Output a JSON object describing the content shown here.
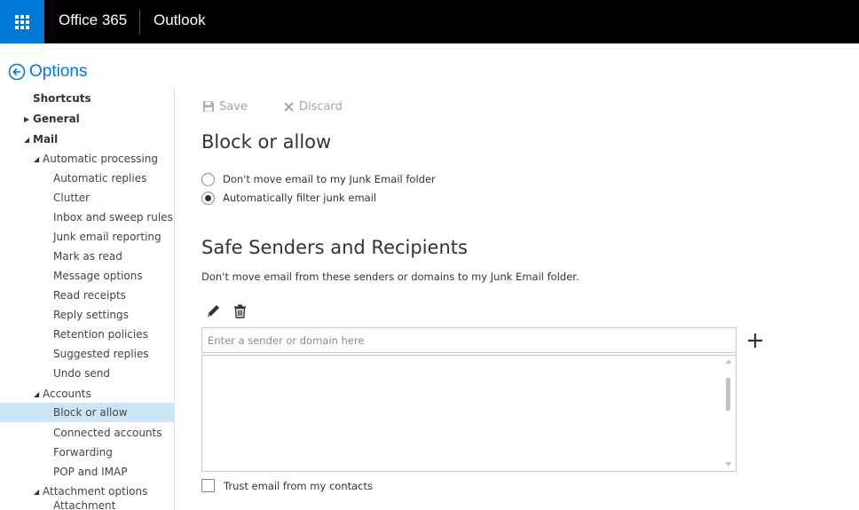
{
  "topbar": {
    "brand": "Office 365",
    "app": "Outlook"
  },
  "options": {
    "title": "Options"
  },
  "sidebar": {
    "items": [
      {
        "label": "Shortcuts"
      },
      {
        "label": "General"
      },
      {
        "label": "Mail"
      },
      {
        "label": "Automatic processing"
      },
      {
        "label": "Automatic replies"
      },
      {
        "label": "Clutter"
      },
      {
        "label": "Inbox and sweep rules"
      },
      {
        "label": "Junk email reporting"
      },
      {
        "label": "Mark as read"
      },
      {
        "label": "Message options"
      },
      {
        "label": "Read receipts"
      },
      {
        "label": "Reply settings"
      },
      {
        "label": "Retention policies"
      },
      {
        "label": "Suggested replies"
      },
      {
        "label": "Undo send"
      },
      {
        "label": "Accounts"
      },
      {
        "label": "Block or allow"
      },
      {
        "label": "Connected accounts"
      },
      {
        "label": "Forwarding"
      },
      {
        "label": "POP and IMAP"
      },
      {
        "label": "Attachment options"
      },
      {
        "label": "Attachment preferences"
      }
    ]
  },
  "toolbar": {
    "save_label": "Save",
    "discard_label": "Discard"
  },
  "main": {
    "title": "Block or allow",
    "radio_dont_move": "Don't move email to my Junk Email folder",
    "radio_auto_filter": "Automatically filter junk email",
    "selected_radio": "auto_filter",
    "safe_title": "Safe Senders and Recipients",
    "safe_desc": "Don't move email from these senders or domains to my Junk Email folder.",
    "sender_placeholder": "Enter a sender or domain here",
    "trust_contacts_label": "Trust email from my contacts",
    "trust_contacts_checked": false
  },
  "colors": {
    "accent": "#0078d7",
    "topbar": "#000000",
    "selected": "#cde6f7"
  }
}
